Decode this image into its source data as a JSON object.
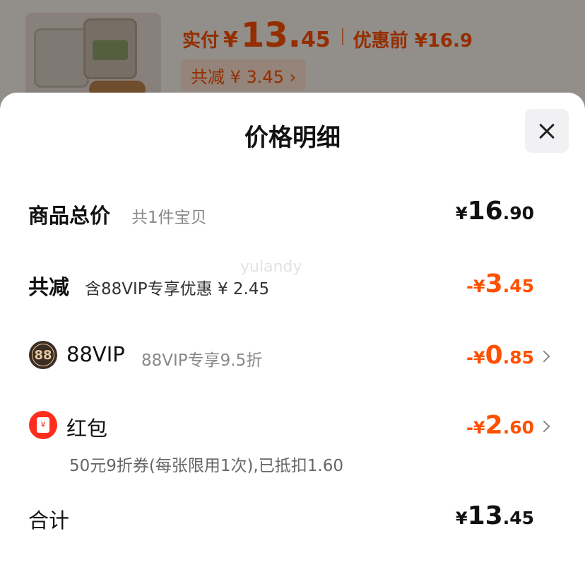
{
  "background": {
    "paid_label": "实付",
    "paid_symbol": "¥",
    "paid_integer": "13.",
    "paid_decimal": "45",
    "before_discount": "优惠前 ¥16.9",
    "total_reduce_chip": "共减 ¥ 3.45 ›"
  },
  "sheet": {
    "title": "价格明细",
    "watermark": "yulandy",
    "goods_total": {
      "label": "商品总价",
      "sub": "共1件宝贝",
      "prefix": "¥",
      "integer": "16",
      "decimal": ".90"
    },
    "total_reduce": {
      "label": "共减",
      "sub": "含88VIP专享优惠 ¥ 2.45",
      "prefix": "-¥",
      "integer": "3",
      "decimal": ".45"
    },
    "vip": {
      "icon_text": "88",
      "name": "88VIP",
      "sub": "88VIP专享9.5折",
      "prefix": "-¥",
      "integer": "0",
      "decimal": ".85"
    },
    "red_packet": {
      "icon_text": "¥",
      "name": "红包",
      "sub": "50元9折券(每张限用1次),已抵扣1.60",
      "prefix": "-¥",
      "integer": "2",
      "decimal": ".60"
    },
    "total": {
      "label": "合计",
      "prefix": "¥",
      "integer": "13",
      "decimal": ".45"
    }
  },
  "colors": {
    "accent": "#ff5000",
    "red_packet": "#ff2d1c",
    "vip_badge": "#3b2d22"
  }
}
